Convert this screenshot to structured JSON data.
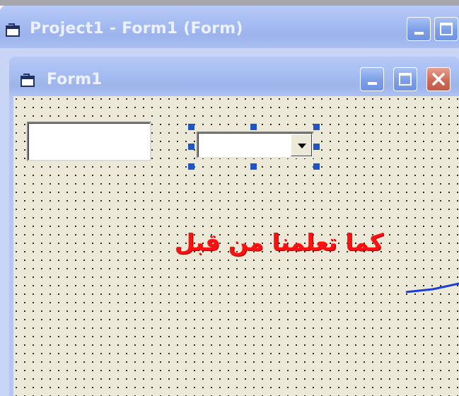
{
  "outer_window": {
    "title": "Project1 - Form1 (Form)",
    "icon": "form-window-icon",
    "buttons": [
      "minimize-icon",
      "maximize-icon"
    ]
  },
  "form_window": {
    "title": "Form1",
    "icon": "form-window-icon",
    "buttons": [
      "minimize-icon",
      "maximize-icon",
      "close-icon"
    ]
  },
  "controls": {
    "textbox_value": "",
    "combobox_value": ""
  },
  "annotation": {
    "text": "كما تعلمنا  من قبل",
    "color": "#ff1010",
    "arrow_color": "#1a3ed8"
  },
  "colors": {
    "title_bar": "#a6bdf2",
    "form_background": "#ece9d8",
    "selection_handle": "#1f55c7",
    "close_button": "#c25b48"
  }
}
